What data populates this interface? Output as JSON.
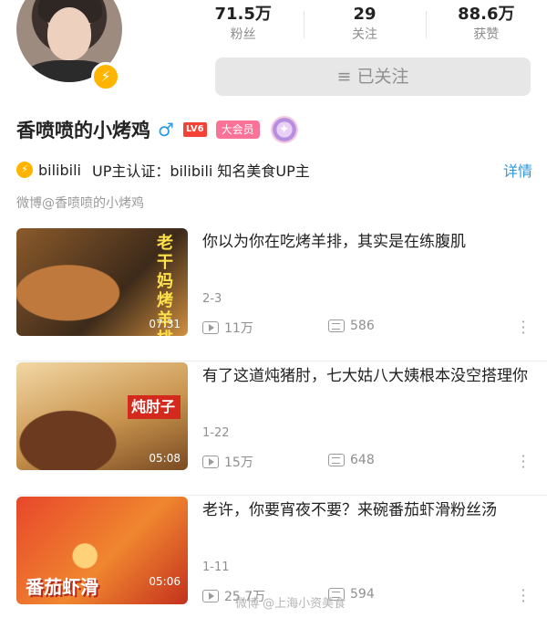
{
  "profile": {
    "name": "香喷喷的小烤鸡",
    "gender_symbol": "♂",
    "level": "LV6",
    "vip_label": "大会员",
    "follow_button": "≡ 已关注",
    "cert_brand": "bilibili",
    "cert_text": "UP主认证：bilibili  知名美食UP主",
    "detail_link": "详情",
    "weibo": "微博@香喷喷的小烤鸡"
  },
  "stats": [
    {
      "value": "71.5万",
      "label": "粉丝"
    },
    {
      "value": "29",
      "label": "关注"
    },
    {
      "value": "88.6万",
      "label": "获赞"
    }
  ],
  "videos": [
    {
      "title": "你以为你在吃烤羊排，其实是在练腹肌",
      "date": "2-3",
      "plays": "11万",
      "danmaku": "586",
      "duration": "07:31",
      "thumb_text": "老干妈烤羊排"
    },
    {
      "title": "有了这道炖猪肘，七大姑八大姨根本没空搭理你",
      "date": "1-22",
      "plays": "15万",
      "danmaku": "648",
      "duration": "05:08",
      "thumb_text": "炖肘子"
    },
    {
      "title": "老许，你要宵夜不要？来碗番茄虾滑粉丝汤",
      "date": "1-11",
      "plays": "25.7万",
      "danmaku": "594",
      "duration": "05:06",
      "thumb_text": "番茄虾滑"
    }
  ],
  "watermark": "微博 @上海小资美食",
  "colors": {
    "vip": "#fb7299",
    "level": "#f44336",
    "link": "#2d97d8",
    "badge": "#ffb400"
  }
}
